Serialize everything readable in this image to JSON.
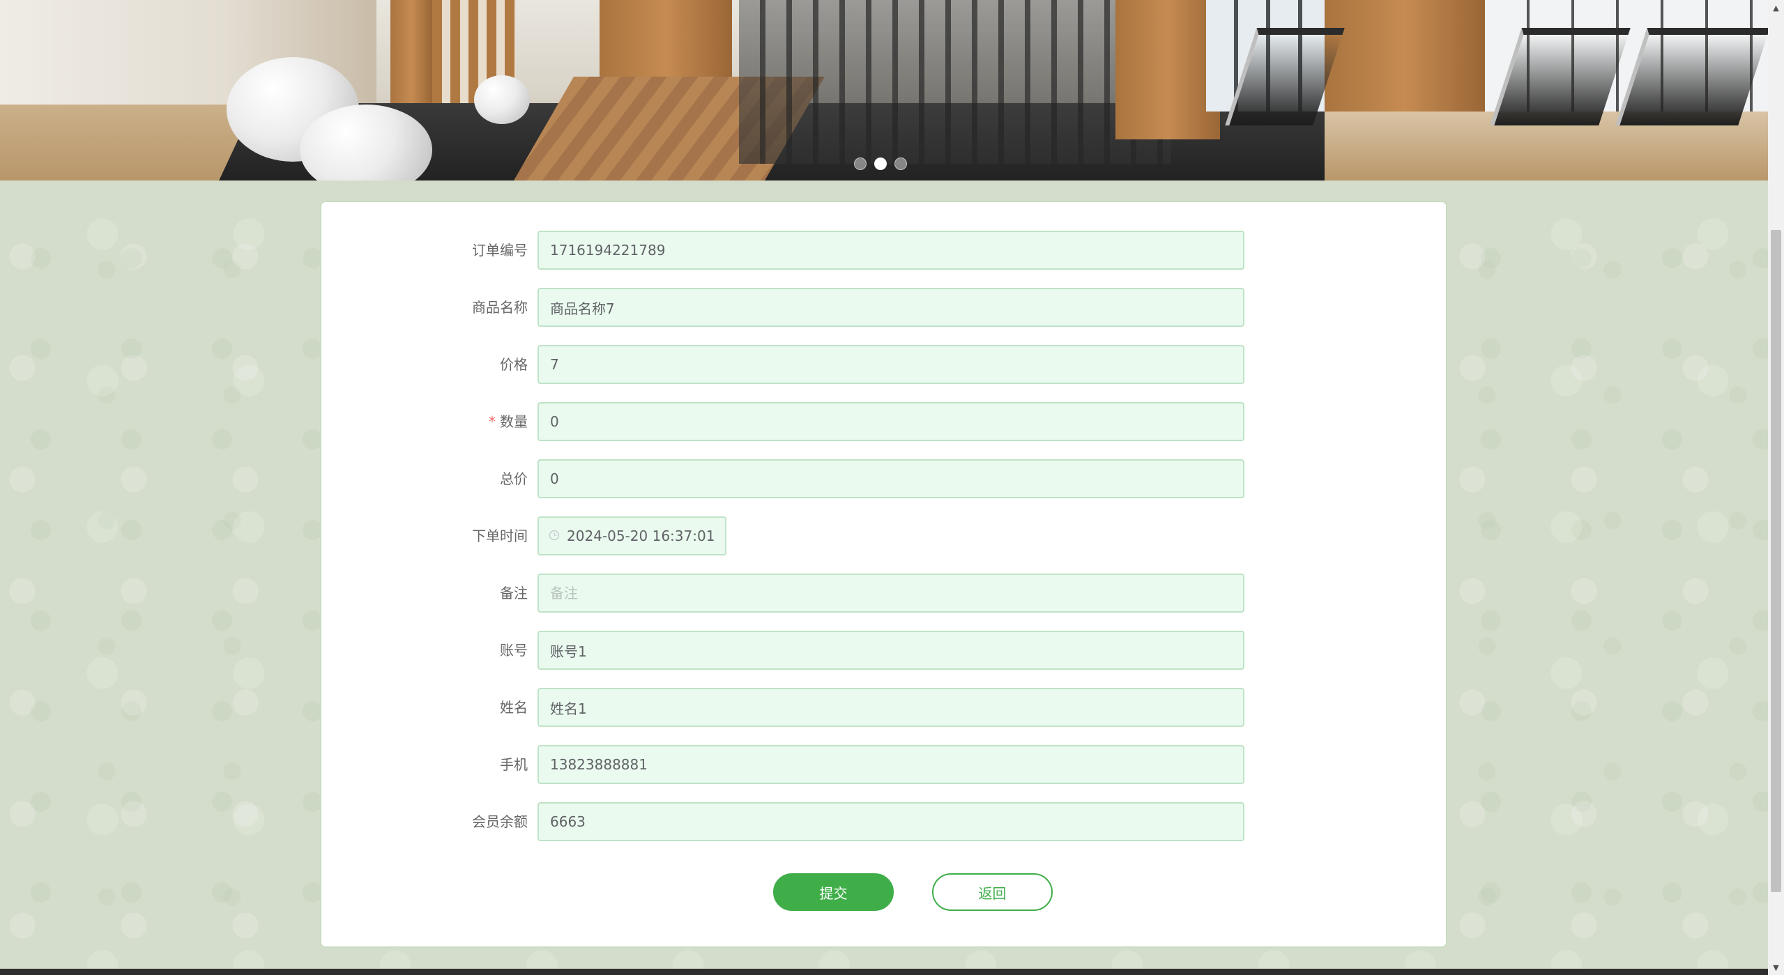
{
  "banner": {
    "carousel_total": 3,
    "carousel_active_index": 1
  },
  "form": {
    "fields": [
      {
        "key": "order_no",
        "label": "订单编号",
        "value": "1716194221789",
        "placeholder": "",
        "required": false
      },
      {
        "key": "goods_name",
        "label": "商品名称",
        "value": "商品名称7",
        "placeholder": "",
        "required": false
      },
      {
        "key": "price",
        "label": "价格",
        "value": "7",
        "placeholder": "",
        "required": false
      },
      {
        "key": "quantity",
        "label": "数量",
        "value": "0",
        "placeholder": "",
        "required": true
      },
      {
        "key": "total_price",
        "label": "总价",
        "value": "0",
        "placeholder": "",
        "required": false
      },
      {
        "key": "order_time",
        "label": "下单时间",
        "value": "2024-05-20 16:37:01",
        "placeholder": "",
        "required": false
      },
      {
        "key": "remark",
        "label": "备注",
        "value": "",
        "placeholder": "备注",
        "required": false
      },
      {
        "key": "account",
        "label": "账号",
        "value": "账号1",
        "placeholder": "",
        "required": false
      },
      {
        "key": "name",
        "label": "姓名",
        "value": "姓名1",
        "placeholder": "",
        "required": false
      },
      {
        "key": "phone",
        "label": "手机",
        "value": "13823888881",
        "placeholder": "",
        "required": false
      },
      {
        "key": "member_balance",
        "label": "会员余额",
        "value": "6663",
        "placeholder": "",
        "required": false
      }
    ],
    "required_mark": "*",
    "submit_label": "提交",
    "back_label": "返回"
  },
  "theme": {
    "primary": "#3fae49",
    "input_bg": "#eafaef",
    "input_border": "#bfe3c6",
    "page_bg": "#d4ddcb"
  },
  "icons": {
    "date_field_icon": "clock-icon"
  }
}
